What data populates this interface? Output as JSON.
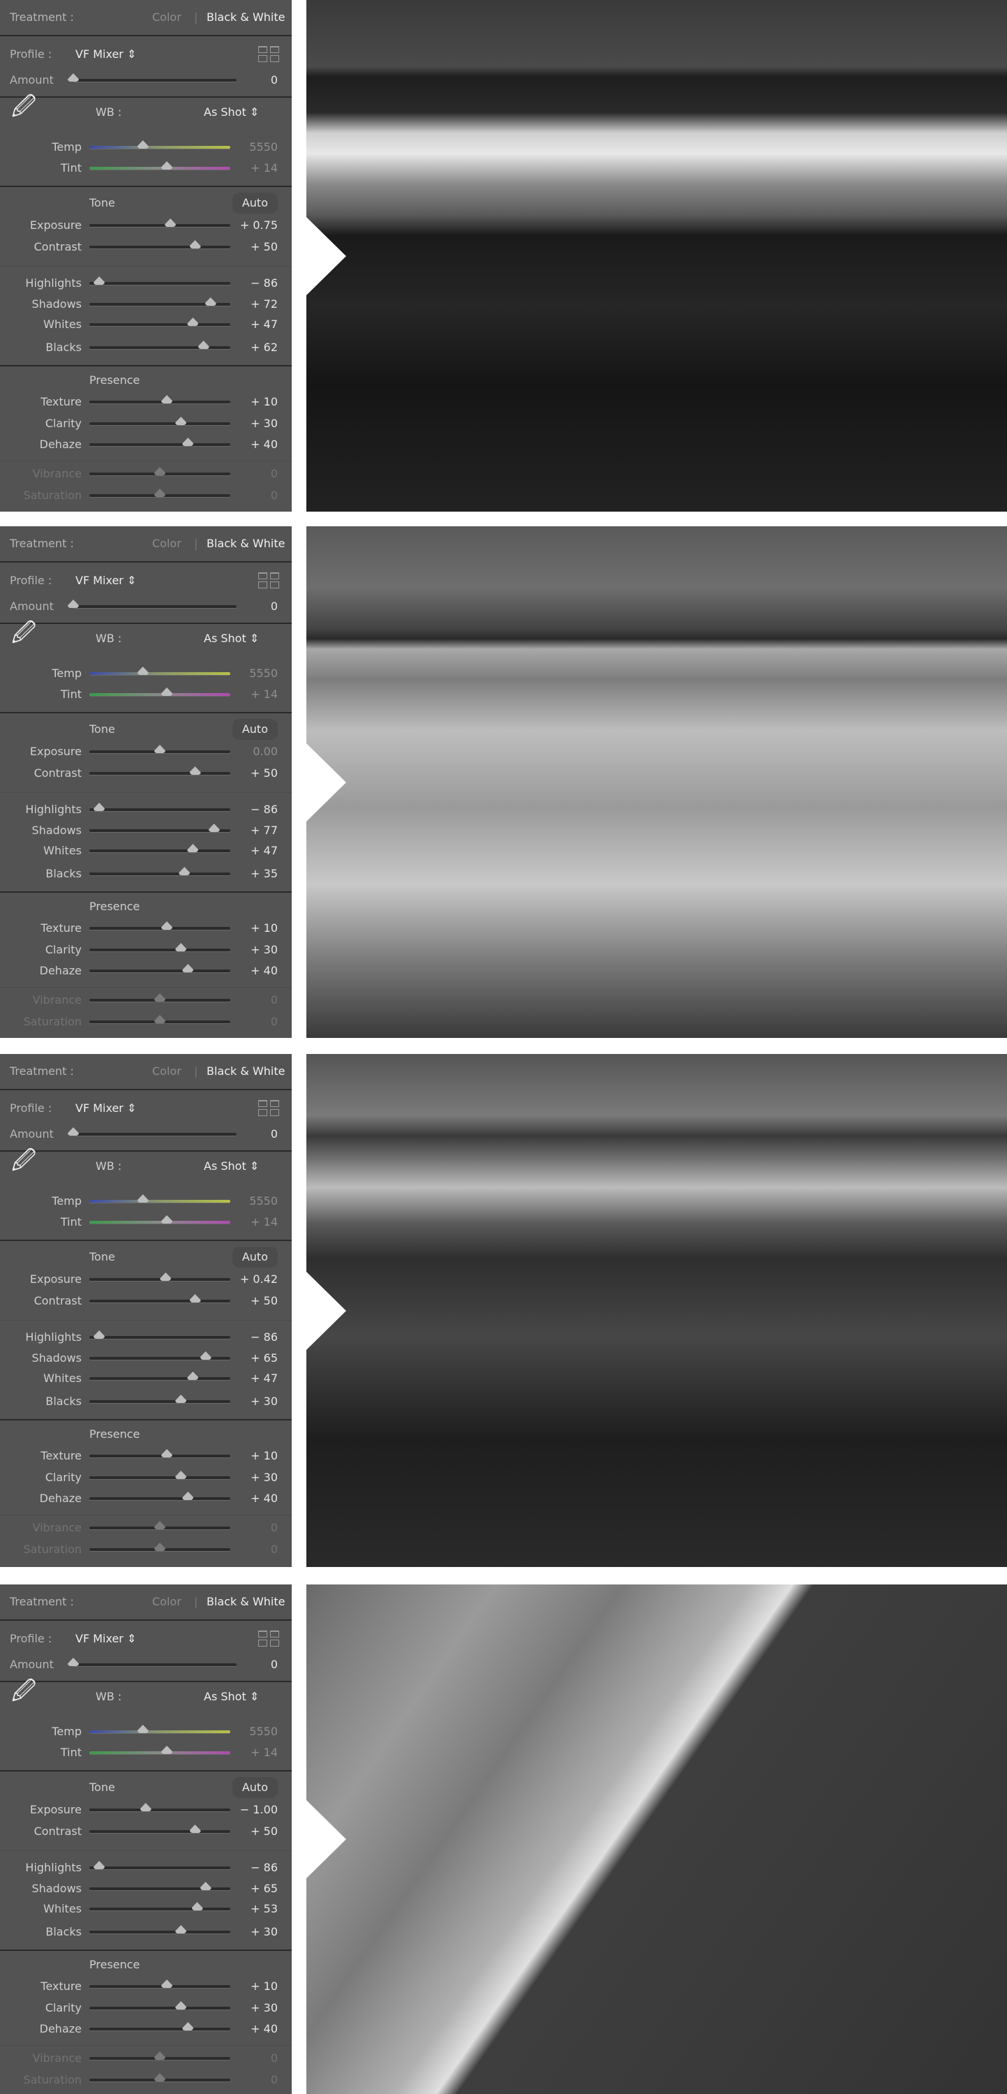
{
  "labels": {
    "treatment": "Treatment :",
    "color": "Color",
    "bw": "Black & White",
    "profile": "Profile :",
    "profile_value": "VF Mixer",
    "amount": "Amount",
    "wb": "WB :",
    "wb_value": "As Shot",
    "temp": "Temp",
    "tint": "Tint",
    "tone": "Tone",
    "auto": "Auto",
    "exposure": "Exposure",
    "contrast": "Contrast",
    "highlights": "Highlights",
    "shadows": "Shadows",
    "whites": "Whites",
    "blacks": "Blacks",
    "presence": "Presence",
    "texture": "Texture",
    "clarity": "Clarity",
    "dehaze": "Dehaze",
    "vibrance": "Vibrance",
    "saturation": "Saturation"
  },
  "icons": {
    "profile_browser": "grid-icon",
    "wb_picker": "eyedropper-icon",
    "stepper": "up-down-chevron-icon",
    "next": "arrow-right-icon"
  },
  "colors": {
    "panel_bg": "#535353",
    "divider": "#2a2a2a",
    "text": "#cfcfcf"
  },
  "slider_positions": {
    "temp": 0.38,
    "tint": 0.55
  },
  "panels": [
    {
      "amount": "0",
      "temp": "5550",
      "tint": "+ 14",
      "exposure": "+ 0.75",
      "contrast": "+ 50",
      "highlights": "− 86",
      "shadows": "+ 72",
      "whites": "+ 47",
      "blacks": "+ 62",
      "texture": "+ 10",
      "clarity": "+ 30",
      "dehaze": "+ 40",
      "vibrance": "0",
      "saturation": "0",
      "levels": {
        "amount": 0,
        "exposure": 0.75,
        "contrast": 50,
        "highlights": -86,
        "shadows": 72,
        "whites": 47,
        "blacks": 62,
        "texture": 10,
        "clarity": 30,
        "dehaze": 40,
        "vibrance": 0,
        "saturation": 0
      }
    },
    {
      "amount": "0",
      "temp": "5550",
      "tint": "+ 14",
      "exposure": "0.00",
      "contrast": "+ 50",
      "highlights": "− 86",
      "shadows": "+ 77",
      "whites": "+ 47",
      "blacks": "+ 35",
      "texture": "+ 10",
      "clarity": "+ 30",
      "dehaze": "+ 40",
      "vibrance": "0",
      "saturation": "0",
      "levels": {
        "amount": 0,
        "exposure": 0,
        "contrast": 50,
        "highlights": -86,
        "shadows": 77,
        "whites": 47,
        "blacks": 35,
        "texture": 10,
        "clarity": 30,
        "dehaze": 40,
        "vibrance": 0,
        "saturation": 0
      }
    },
    {
      "amount": "0",
      "temp": "5550",
      "tint": "+ 14",
      "exposure": "+ 0.42",
      "contrast": "+ 50",
      "highlights": "− 86",
      "shadows": "+ 65",
      "whites": "+ 47",
      "blacks": "+ 30",
      "texture": "+ 10",
      "clarity": "+ 30",
      "dehaze": "+ 40",
      "vibrance": "0",
      "saturation": "0",
      "levels": {
        "amount": 0,
        "exposure": 0.42,
        "contrast": 50,
        "highlights": -86,
        "shadows": 65,
        "whites": 47,
        "blacks": 30,
        "texture": 10,
        "clarity": 30,
        "dehaze": 40,
        "vibrance": 0,
        "saturation": 0
      }
    },
    {
      "amount": "0",
      "temp": "5550",
      "tint": "+ 14",
      "exposure": "− 1.00",
      "contrast": "+ 50",
      "highlights": "− 86",
      "shadows": "+ 65",
      "whites": "+ 53",
      "blacks": "+ 30",
      "texture": "+ 10",
      "clarity": "+ 30",
      "dehaze": "+ 40",
      "vibrance": "0",
      "saturation": "0",
      "levels": {
        "amount": 0,
        "exposure": -1,
        "contrast": 50,
        "highlights": -86,
        "shadows": 65,
        "whites": 53,
        "blacks": 30,
        "texture": 10,
        "clarity": 30,
        "dehaze": 40,
        "vibrance": 0,
        "saturation": 0
      }
    }
  ]
}
